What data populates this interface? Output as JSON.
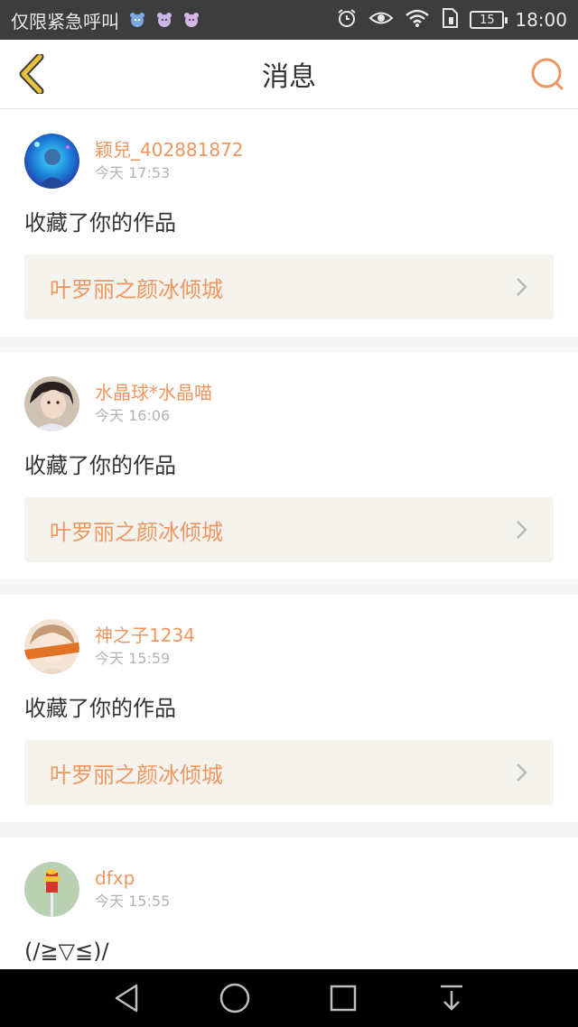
{
  "status_bar": {
    "carrier": "仅限紧急呼叫",
    "battery": "15",
    "time": "18:00",
    "icons": [
      "alarm-icon",
      "eye-icon",
      "wifi-icon",
      "sim-icon",
      "battery-icon"
    ]
  },
  "header": {
    "title": "消息",
    "back_icon": "chevron-left-icon",
    "search_icon": "search-icon"
  },
  "colors": {
    "accent": "#ee9660",
    "back_arrow": "#e8c23c",
    "link_bg": "#f4f3ee"
  },
  "messages": [
    {
      "username": "颖兒_402881872",
      "time": "今天 17:53",
      "action": "收藏了你的作品",
      "work": "叶罗丽之颜冰倾城"
    },
    {
      "username": "水晶球*水晶喵",
      "time": "今天 16:06",
      "action": "收藏了你的作品",
      "work": "叶罗丽之颜冰倾城"
    },
    {
      "username": "神之子1234",
      "time": "今天 15:59",
      "action": "收藏了你的作品",
      "work": "叶罗丽之颜冰倾城"
    },
    {
      "username": "dfxp",
      "time": "今天 15:55",
      "action": "(/≧▽≦)/",
      "work": ""
    }
  ],
  "nav_bar": [
    "back-triangle-icon",
    "home-circle-icon",
    "recents-square-icon",
    "notification-pulldown-icon"
  ]
}
